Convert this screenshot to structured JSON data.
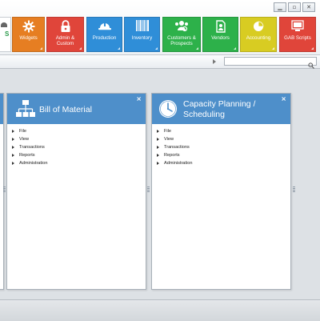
{
  "window": {
    "controls": [
      "▁",
      "▫",
      "✕"
    ]
  },
  "ribbon": {
    "partial_tile_text": "S",
    "tiles": [
      {
        "label": "Widgets",
        "color": "#e67e22",
        "icon": "gear-icon"
      },
      {
        "label": "Admin & Custom",
        "color": "#e0453a",
        "icon": "lock-icon"
      },
      {
        "label": "Production",
        "color": "#2f8ed8",
        "icon": "hardhat-icon"
      },
      {
        "label": "Inventory",
        "color": "#2f8ed8",
        "icon": "barcode-icon"
      },
      {
        "label": "Customers & Prospects",
        "color": "#2db14a",
        "icon": "people-icon"
      },
      {
        "label": "Vendors",
        "color": "#2db14a",
        "icon": "document-icon"
      },
      {
        "label": "Accounting",
        "color": "#d8cc22",
        "icon": "pie-chart-icon"
      },
      {
        "label": "GAB Scripts",
        "color": "#e0453a",
        "icon": "script-icon"
      }
    ]
  },
  "search": {
    "placeholder": ""
  },
  "panels": [
    {
      "title": "Bill of Material",
      "icon": "hierarchy-icon",
      "items": [
        "File",
        "View",
        "Transactions",
        "Reports",
        "Administration"
      ]
    },
    {
      "title": "Capacity Planning / Scheduling",
      "icon": "clock-icon",
      "items": [
        "File",
        "View",
        "Transactions",
        "Reports",
        "Administration"
      ]
    }
  ],
  "close_glyph": "×"
}
